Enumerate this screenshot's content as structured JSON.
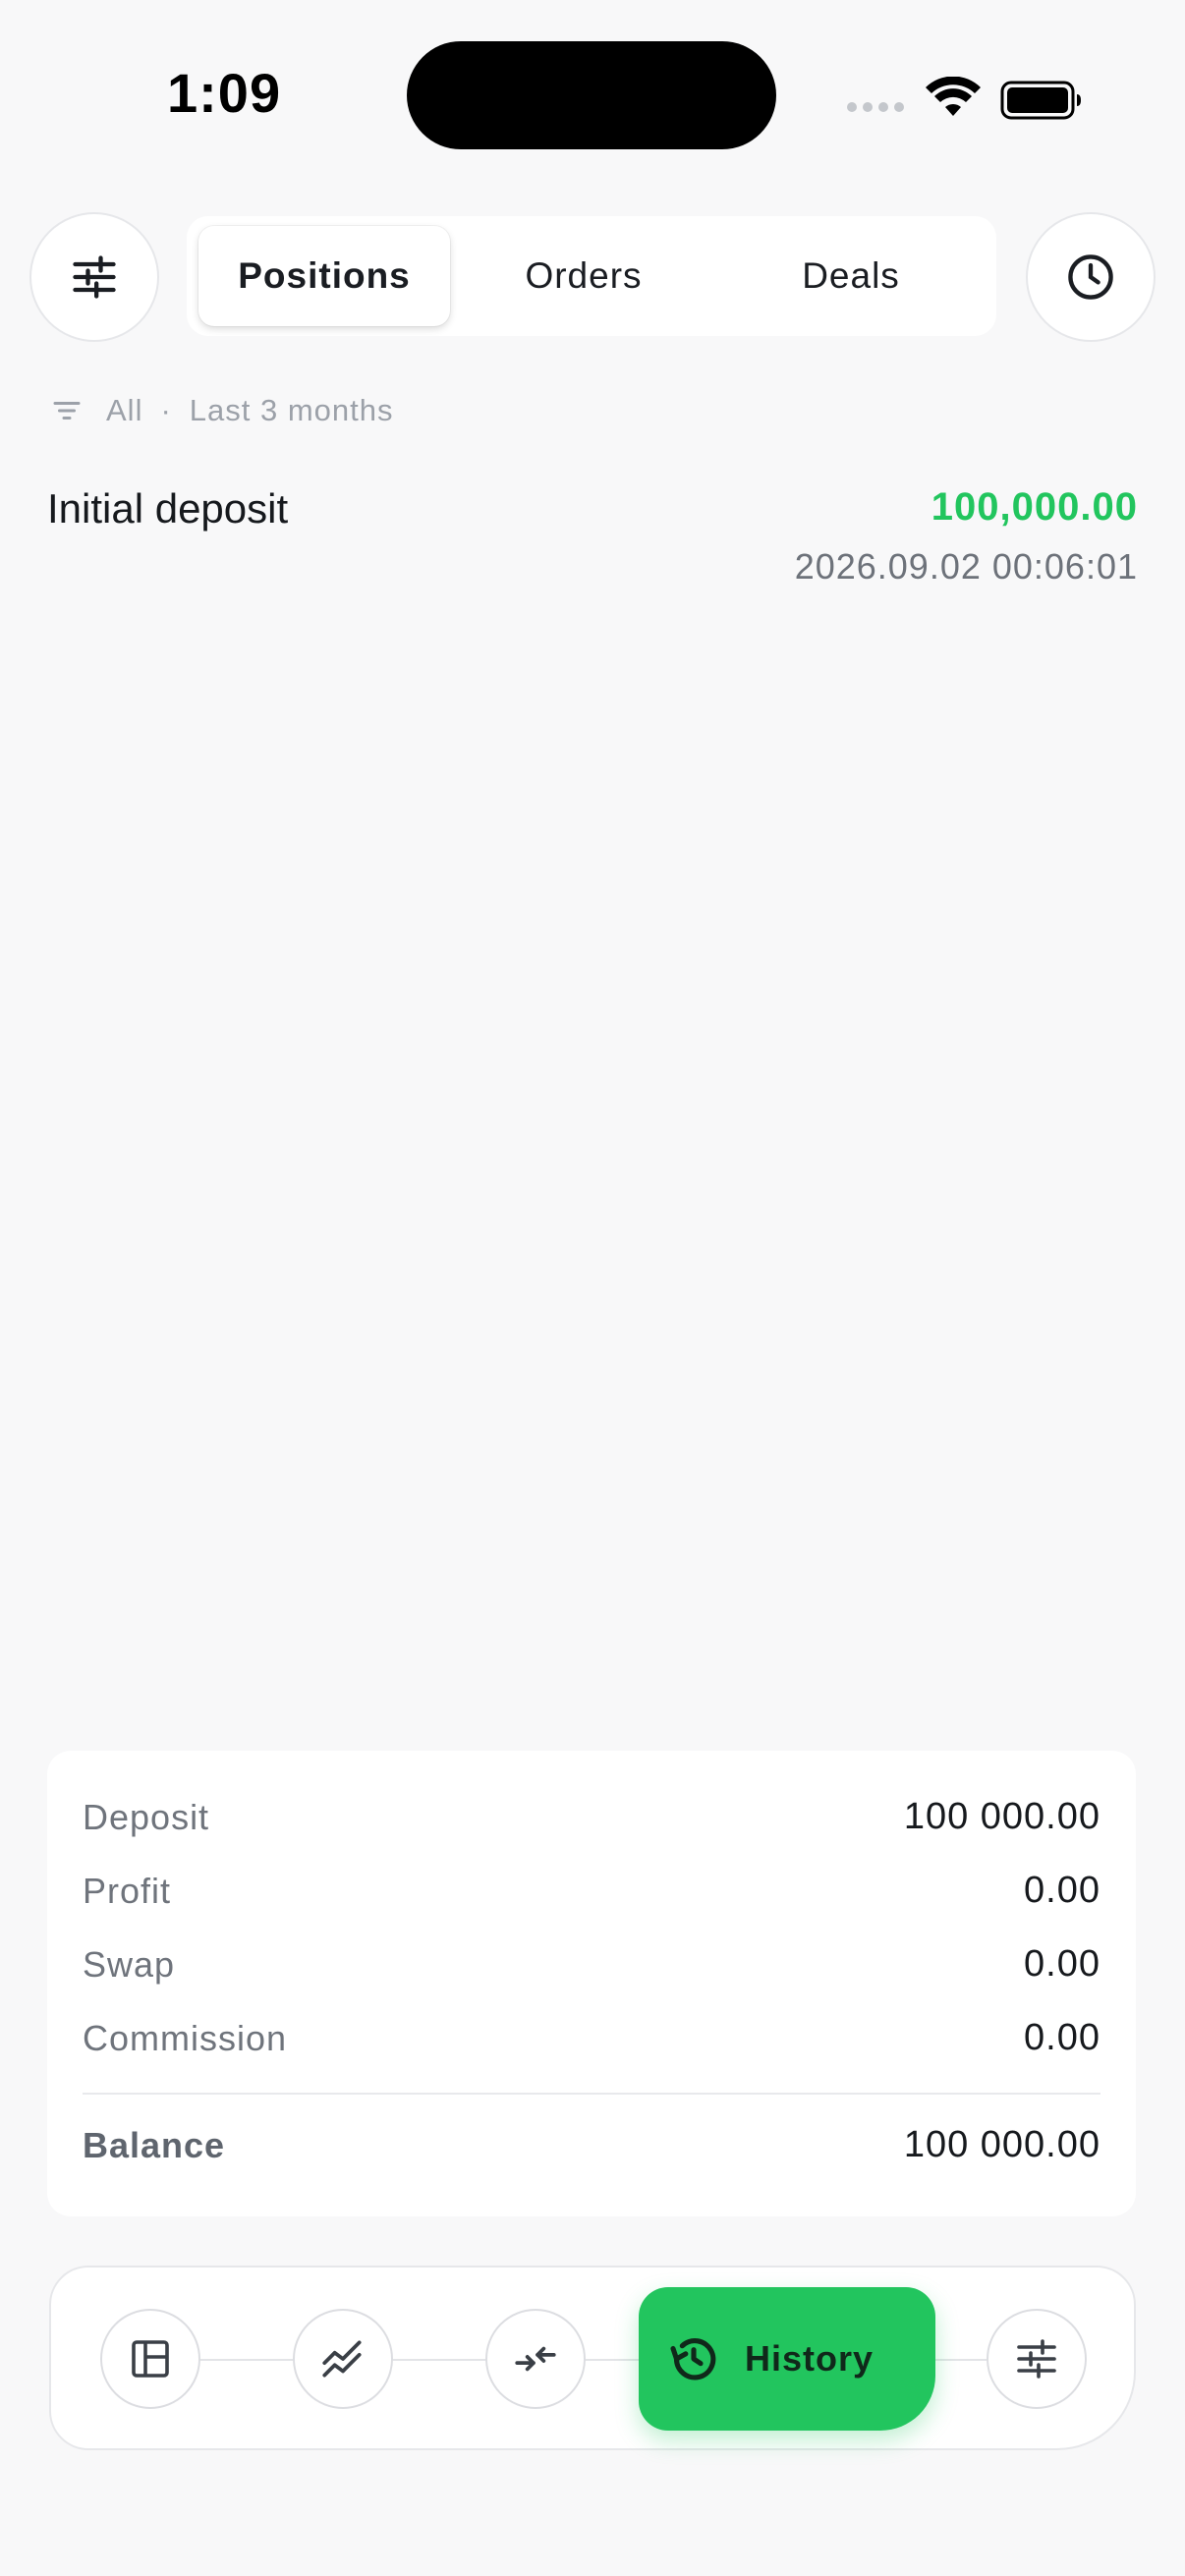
{
  "status_bar": {
    "time": "1:09"
  },
  "header": {
    "filter_button_icon": "sliders-icon",
    "history_clock_icon": "clock-icon",
    "tabs": [
      {
        "label": "Positions",
        "active": true
      },
      {
        "label": "Orders",
        "active": false
      },
      {
        "label": "Deals",
        "active": false
      }
    ]
  },
  "filter": {
    "type": "All",
    "period": "Last 3 months",
    "separator": "·"
  },
  "entries": [
    {
      "title": "Initial deposit",
      "amount": "100,000.00",
      "date": "2026.09.02 00:06:01"
    }
  ],
  "summary": {
    "rows": [
      {
        "label": "Deposit",
        "value": "100 000.00"
      },
      {
        "label": "Profit",
        "value": "0.00"
      },
      {
        "label": "Swap",
        "value": "0.00"
      },
      {
        "label": "Commission",
        "value": "0.00"
      }
    ],
    "total": {
      "label": "Balance",
      "value": "100 000.00"
    }
  },
  "bottom_nav": {
    "items": [
      {
        "icon": "layout-icon"
      },
      {
        "icon": "chart-trend-icon"
      },
      {
        "icon": "trade-arrows-icon"
      },
      {
        "icon": "history-icon",
        "label": "History",
        "active": true
      },
      {
        "icon": "sliders-icon"
      }
    ]
  },
  "colors": {
    "accent_green": "#22c55e",
    "background": "#f8f8f9",
    "card": "#ffffff"
  }
}
